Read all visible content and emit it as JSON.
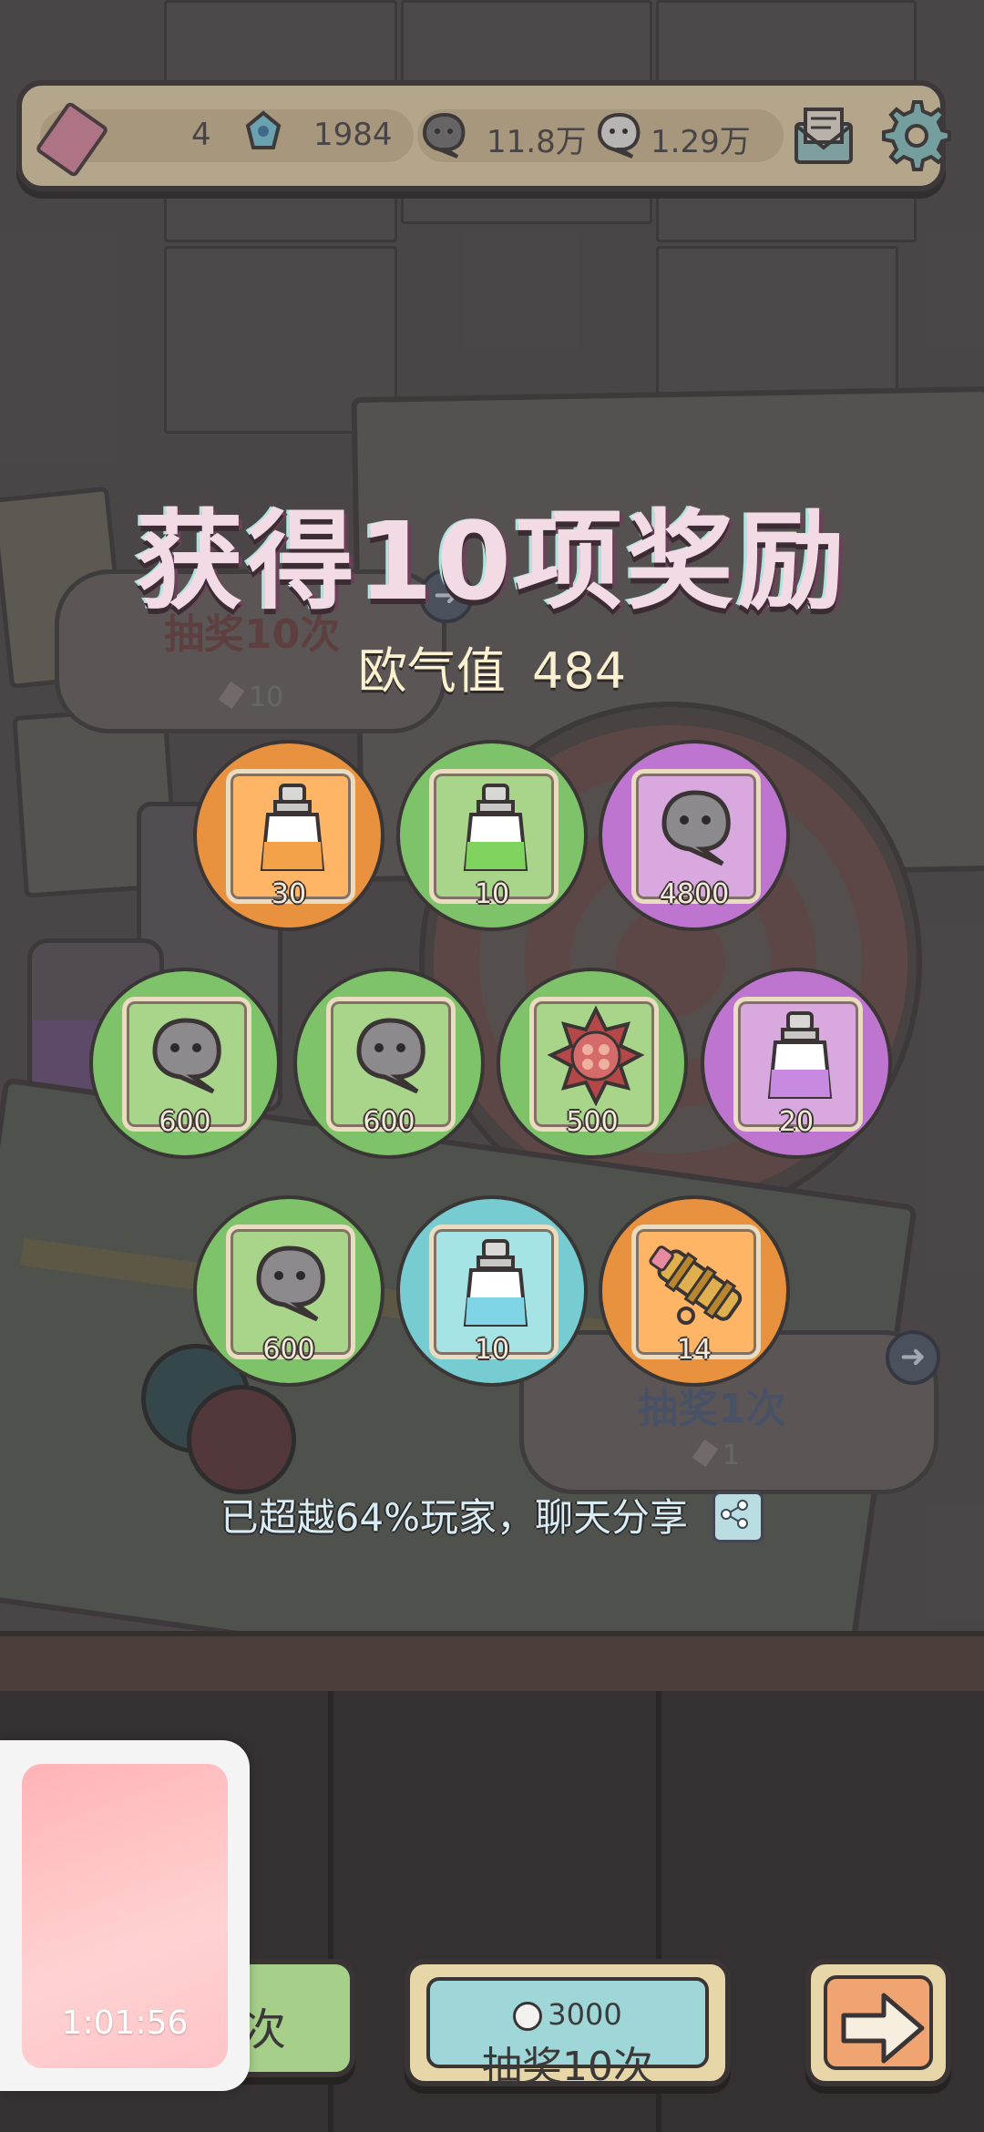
{
  "header": {
    "tickets": "",
    "candy": "4",
    "soul_small": "1984",
    "soul_gray": "11.8万",
    "soul_white": "1.29万"
  },
  "draw_panel": {
    "ten_draw_label": "抽奖10次",
    "ten_draw_cost": "10",
    "one_draw_label": "抽奖1次",
    "one_draw_cost": "1"
  },
  "result": {
    "title": "获得10项奖励",
    "luck_label": "欧气值",
    "luck_value": "484",
    "share_text": "已超越64%玩家，聊天分享"
  },
  "rewards": [
    {
      "item": "potion-orange",
      "qty": "30",
      "rarity": "orange"
    },
    {
      "item": "potion-green",
      "qty": "10",
      "rarity": "green"
    },
    {
      "item": "soul-gray",
      "qty": "4800",
      "rarity": "purple"
    },
    {
      "item": "soul-gray",
      "qty": "600",
      "rarity": "green"
    },
    {
      "item": "soul-gray",
      "qty": "600",
      "rarity": "green"
    },
    {
      "item": "spiky-shell",
      "qty": "500",
      "rarity": "green"
    },
    {
      "item": "potion-purple",
      "qty": "20",
      "rarity": "purple"
    },
    {
      "item": "soul-gray",
      "qty": "600",
      "rarity": "green"
    },
    {
      "item": "potion-cyan",
      "qty": "10",
      "rarity": "cyan"
    },
    {
      "item": "spyglass",
      "qty": "14",
      "rarity": "orange"
    }
  ],
  "bottom": {
    "left_button_label": "次",
    "ten_cost": "3000",
    "ten_label": "抽奖10次"
  },
  "float_window": {
    "timer": "1:01:56"
  },
  "colors": {
    "orange": "#e8923f",
    "green": "#7ec26a",
    "purple": "#be75cf",
    "cyan": "#76ccd0"
  }
}
